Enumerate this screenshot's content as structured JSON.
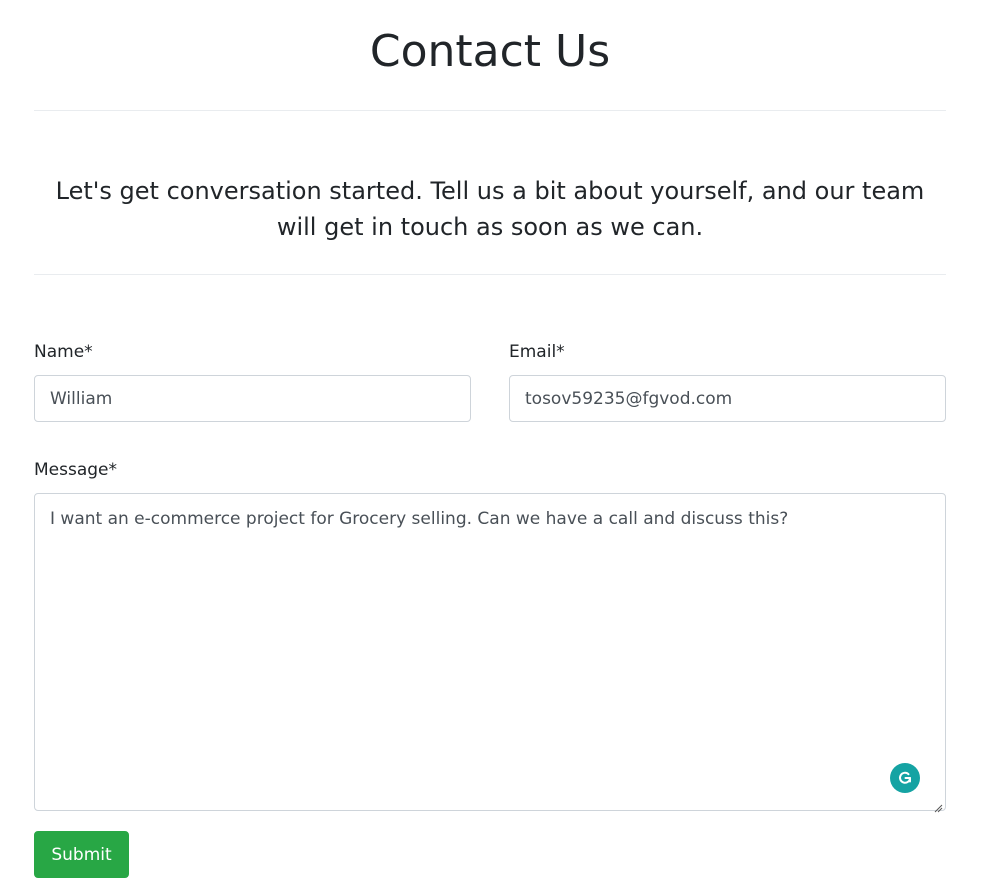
{
  "page": {
    "title": "Contact Us",
    "intro": "Let's get conversation started. Tell us a bit about yourself, and our team will get in touch as soon as we can."
  },
  "form": {
    "name": {
      "label": "Name*",
      "value": "William"
    },
    "email": {
      "label": "Email*",
      "value": "tosov59235@fgvod.com"
    },
    "message": {
      "label": "Message*",
      "value": "I want an e-commerce project for Grocery selling. Can we have a call and discuss this?"
    },
    "submit_label": "Submit"
  },
  "icons": {
    "grammarly": "grammarly-icon",
    "resize": "resize-handle-icon"
  },
  "colors": {
    "submit": "#28a745",
    "grammarly": "#15a3a3",
    "border": "#ced4da",
    "text": "#212529"
  }
}
